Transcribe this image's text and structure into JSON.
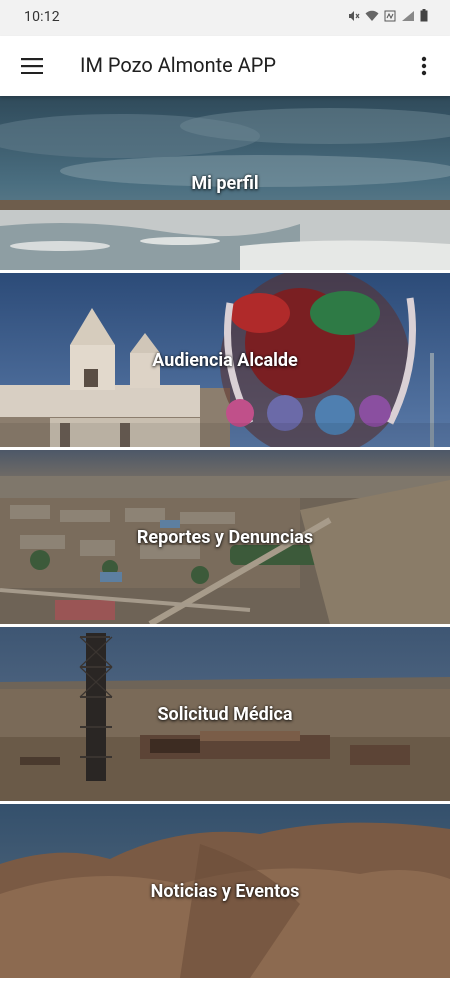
{
  "status": {
    "time": "10:12",
    "icons": [
      "mute-icon",
      "wifi-icon",
      "data-icon",
      "signal-icon",
      "battery-icon"
    ]
  },
  "app_bar": {
    "title": "IM Pozo Almonte APP",
    "menu_icon": "hamburger-menu-icon",
    "overflow_icon": "more-vert-icon"
  },
  "menu_items": [
    {
      "label": "Mi perfil",
      "scene": "salt-flat"
    },
    {
      "label": "Audiencia Alcalde",
      "scene": "church-and-mask"
    },
    {
      "label": "Reportes y Denuncias",
      "scene": "town-aerial"
    },
    {
      "label": "Solicitud Médica",
      "scene": "mining-ruins"
    },
    {
      "label": "Noticias y Eventos",
      "scene": "desert-hills"
    }
  ]
}
